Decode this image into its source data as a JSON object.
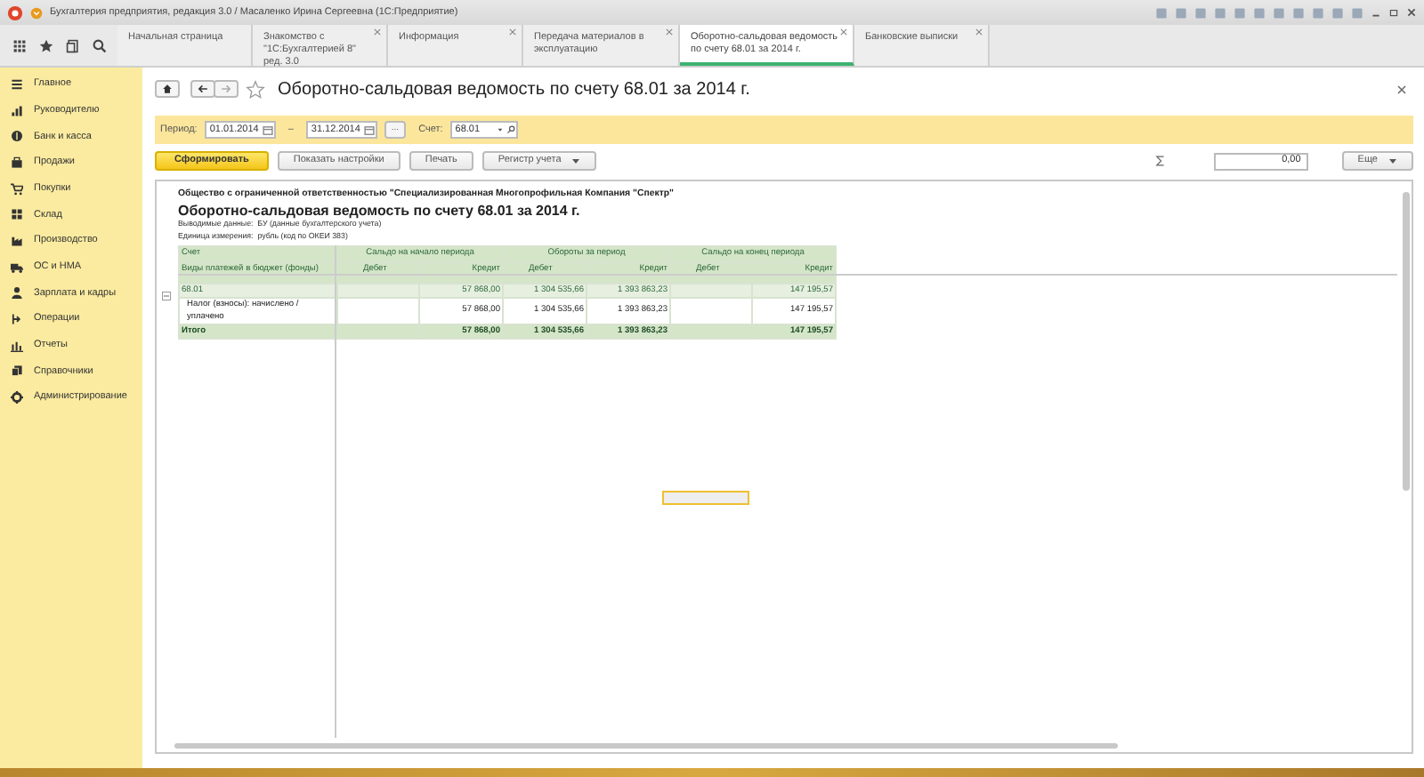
{
  "window": {
    "title": "Бухгалтерия предприятия, редакция 3.0 / Масаленко Ирина Сергеевна (1С:Предприятие)"
  },
  "tabs": [
    {
      "label": "Начальная страница",
      "selected": false,
      "closable": false
    },
    {
      "label": "Знакомство с \"1С:Бухгалтерией 8\" ред. 3.0",
      "selected": false,
      "closable": true
    },
    {
      "label": "Информация",
      "selected": false,
      "closable": true
    },
    {
      "label": "Передача материалов в эксплуатацию",
      "selected": false,
      "closable": true
    },
    {
      "label": "Оборотно-сальдовая ведомость по счету 68.01 за 2014 г.",
      "selected": true,
      "closable": true
    },
    {
      "label": "Банковские выписки",
      "selected": false,
      "closable": true
    }
  ],
  "sidebar": {
    "items": [
      {
        "label": "Главное"
      },
      {
        "label": "Руководителю"
      },
      {
        "label": "Банк и касса"
      },
      {
        "label": "Продажи"
      },
      {
        "label": "Покупки"
      },
      {
        "label": "Склад"
      },
      {
        "label": "Производство"
      },
      {
        "label": "ОС и НМА"
      },
      {
        "label": "Зарплата и кадры"
      },
      {
        "label": "Операции"
      },
      {
        "label": "Отчеты"
      },
      {
        "label": "Справочники"
      },
      {
        "label": "Администрирование"
      }
    ]
  },
  "form": {
    "title": "Оборотно-сальдовая ведомость по счету 68.01 за 2014 г.",
    "period_label": "Период:",
    "date_from": "01.01.2014",
    "dash": "–",
    "date_to": "31.12.2014",
    "ellipsis": "...",
    "account_label": "Счет:",
    "account": "68.01",
    "buttons": [
      {
        "label": "Сформировать",
        "kind": "primary"
      },
      {
        "label": "Показать настройки",
        "kind": "plain"
      },
      {
        "label": "Печать",
        "kind": "plain"
      },
      {
        "label": "Регистр учета",
        "kind": "dropdown"
      }
    ],
    "sum_value": "0,00",
    "more_button": "Еще"
  },
  "report": {
    "organization": "Общество с ограниченной ответственностью \"Специализированная Многопрофильная Компания \"Спектр\"",
    "title": "Оборотно-сальдовая ведомость по счету 68.01 за 2014 г.",
    "info": [
      {
        "label": "Выводимые данные:",
        "value": "БУ (данные бухгалтерского учета)"
      },
      {
        "label": "Единица измерения:",
        "value": "рубль (код по ОКЕИ 383)"
      }
    ],
    "header_groups": [
      "Счет",
      "Сальдо на начало периода",
      "Обороты за период",
      "Сальдо на конец периода"
    ],
    "columns": [
      "Виды платежей в бюджет (фонды)",
      "Дебет",
      "Кредит",
      "Дебет",
      "Кредит",
      "Дебет",
      "Кредит"
    ],
    "rows": [
      {
        "kind": "group",
        "expanded": true,
        "cells": [
          "68.01",
          "",
          "57 868,00",
          "1 304 535,66",
          "1 393 863,23",
          "",
          "147 195,57"
        ]
      },
      {
        "kind": "detail",
        "cells": [
          "Налог (взносы): начислено / уплачено",
          "",
          "57 868,00",
          "1 304 535,66",
          "1 393 863,23",
          "",
          "147 195,57"
        ]
      },
      {
        "kind": "total",
        "cells": [
          "Итого",
          "",
          "57 868,00",
          "1 304 535,66",
          "1 393 863,23",
          "",
          "147 195,57"
        ]
      }
    ]
  }
}
